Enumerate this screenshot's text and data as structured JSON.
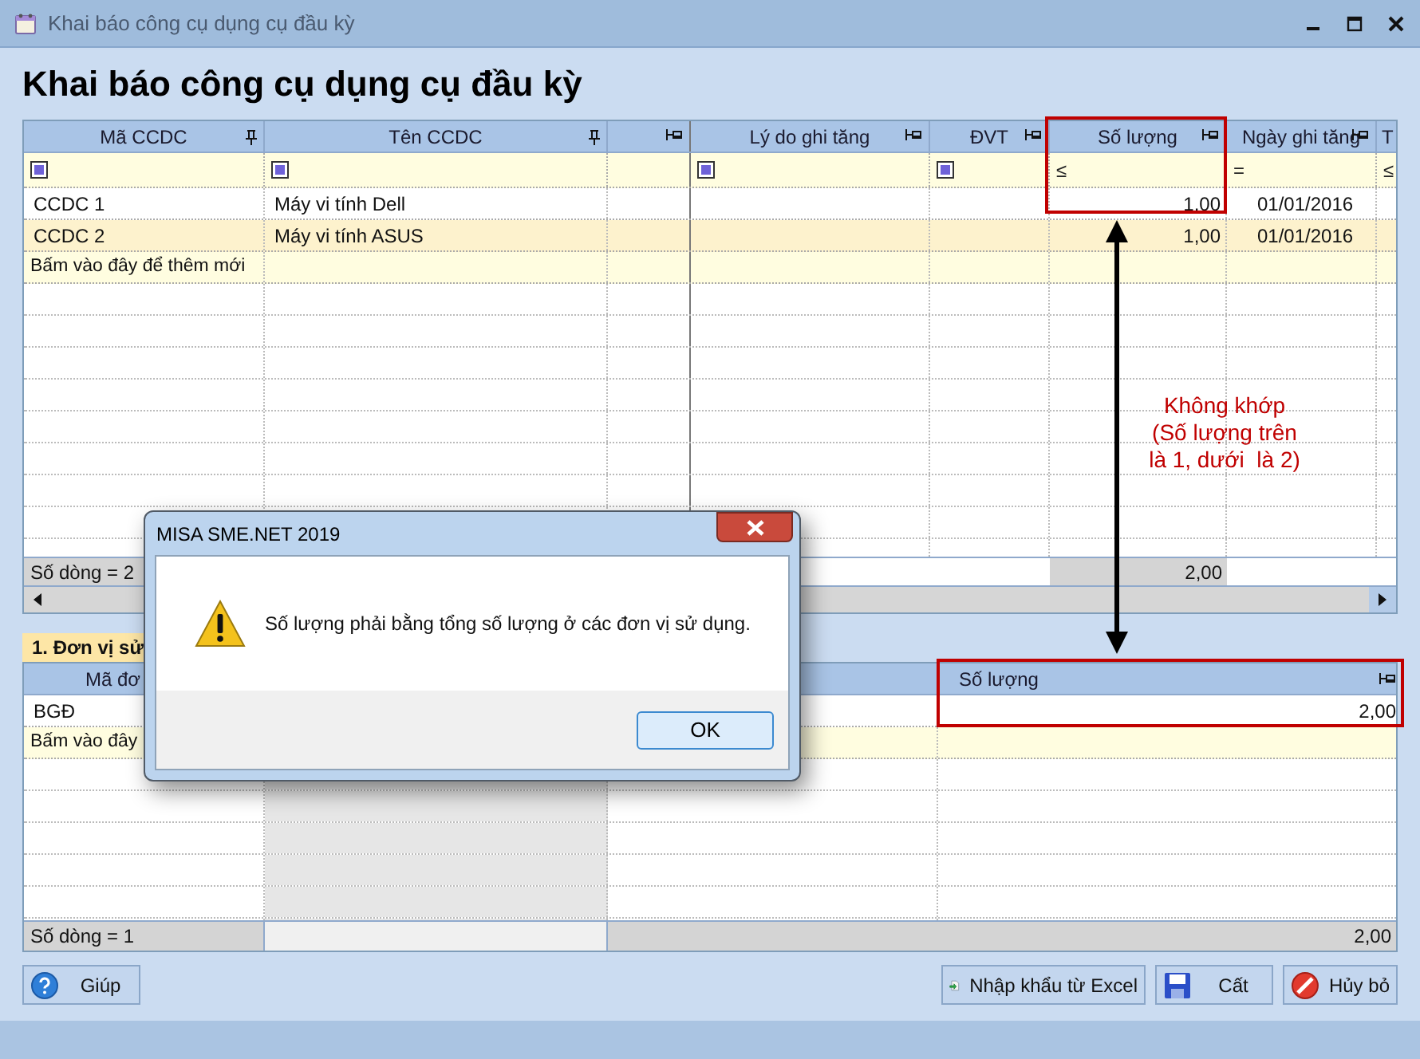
{
  "window": {
    "title": "Khai báo công cụ dụng cụ đầu kỳ"
  },
  "heading": "Khai báo công cụ dụng cụ đầu kỳ",
  "main_grid": {
    "columns": [
      {
        "label": "Mã CCDC",
        "filter": {
          "kind": "icon"
        }
      },
      {
        "label": "Tên CCDC",
        "filter": {
          "kind": "icon"
        }
      },
      {
        "filter": {
          "kind": "none"
        }
      },
      {
        "label": "Lý do ghi tăng",
        "filter": {
          "kind": "icon"
        }
      },
      {
        "label": "ĐVT",
        "filter": {
          "kind": "icon"
        }
      },
      {
        "label": "Số lượng",
        "filter": {
          "kind": "operator",
          "text": "≤"
        }
      },
      {
        "label": "Ngày ghi tăng",
        "filter": {
          "kind": "operator",
          "text": "="
        }
      },
      {
        "label": "T",
        "filter": {
          "kind": "operator",
          "text": "≤"
        }
      }
    ],
    "rows": [
      {
        "code": "CCDC 1",
        "name": "Máy vi tính Dell",
        "quantity": "1,00",
        "date": "01/01/2016",
        "selected": false
      },
      {
        "code": "CCDC 2",
        "name": "Máy vi tính ASUS",
        "quantity": "1,00",
        "date": "01/01/2016",
        "selected": true
      }
    ],
    "add_row": "Bấm vào đây để thêm mới",
    "footer": {
      "count": "Số dòng = 2",
      "quantity_total": "2,00"
    }
  },
  "units_tab": "1. Đơn vị sử",
  "units_grid": {
    "columns": [
      {
        "label": "Mã đơ"
      },
      {
        "label": "Số lượng"
      }
    ],
    "rows": [
      {
        "code": "BGĐ",
        "quantity": "2,00"
      }
    ],
    "add_row": "Bấm vào đây",
    "footer": {
      "count": "Số dòng = 1",
      "quantity_total": "2,00"
    }
  },
  "buttons": [
    {
      "label": "Giúp"
    },
    {
      "label": "Nhập khẩu từ Excel"
    },
    {
      "label": "Cất"
    },
    {
      "label": "Hủy bỏ"
    }
  ],
  "dialog": {
    "title": "MISA SME.NET 2019",
    "message": "Số lượng phải bằng tổng số lượng ở các đơn vị sử dụng.",
    "buttons": [
      "OK"
    ]
  },
  "callout": {
    "text": "Không khớp\n(Số lượng trên\nlà 1, dưới  là 2)"
  }
}
